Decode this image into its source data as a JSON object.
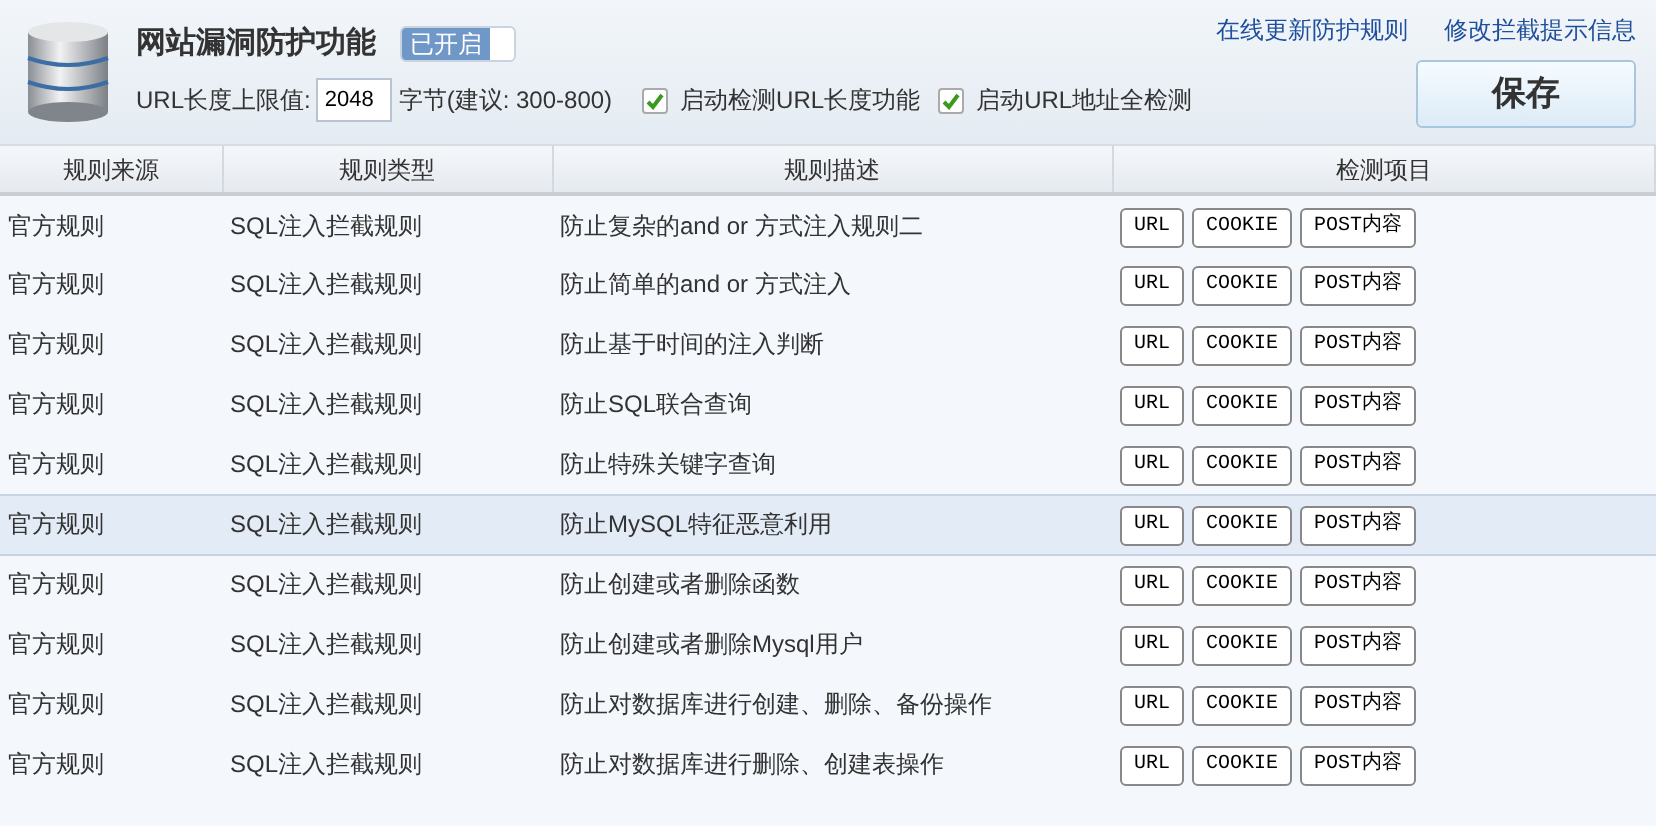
{
  "header": {
    "title": "网站漏洞防护功能",
    "toggle": {
      "label": "已开启",
      "on": true
    },
    "url_limit": {
      "label": "URL长度上限值:",
      "value": "2048",
      "suffix": "字节(建议: 300-800)"
    },
    "options": [
      {
        "label": "启动检测URL长度功能",
        "checked": true
      },
      {
        "label": "启动URL地址全检测",
        "checked": true
      }
    ],
    "links": [
      "在线更新防护规则",
      "修改拦截提示信息"
    ],
    "save_button": "保存"
  },
  "table": {
    "columns": [
      "规则来源",
      "规则类型",
      "规则描述",
      "检测项目"
    ],
    "rows": [
      {
        "source": "官方规则",
        "type": "SQL注入拦截规则",
        "description": "防止复杂的and or 方式注入规则二",
        "checks": [
          "URL",
          "COOKIE",
          "POST内容"
        ],
        "selected": false
      },
      {
        "source": "官方规则",
        "type": "SQL注入拦截规则",
        "description": "防止简单的and or 方式注入",
        "checks": [
          "URL",
          "COOKIE",
          "POST内容"
        ],
        "selected": false
      },
      {
        "source": "官方规则",
        "type": "SQL注入拦截规则",
        "description": "防止基于时间的注入判断",
        "checks": [
          "URL",
          "COOKIE",
          "POST内容"
        ],
        "selected": false
      },
      {
        "source": "官方规则",
        "type": "SQL注入拦截规则",
        "description": "防止SQL联合查询",
        "checks": [
          "URL",
          "COOKIE",
          "POST内容"
        ],
        "selected": false
      },
      {
        "source": "官方规则",
        "type": "SQL注入拦截规则",
        "description": "防止特殊关键字查询",
        "checks": [
          "URL",
          "COOKIE",
          "POST内容"
        ],
        "selected": false
      },
      {
        "source": "官方规则",
        "type": "SQL注入拦截规则",
        "description": "防止MySQL特征恶意利用",
        "checks": [
          "URL",
          "COOKIE",
          "POST内容"
        ],
        "selected": true
      },
      {
        "source": "官方规则",
        "type": "SQL注入拦截规则",
        "description": "防止创建或者删除函数",
        "checks": [
          "URL",
          "COOKIE",
          "POST内容"
        ],
        "selected": false
      },
      {
        "source": "官方规则",
        "type": "SQL注入拦截规则",
        "description": "防止创建或者删除Mysql用户",
        "checks": [
          "URL",
          "COOKIE",
          "POST内容"
        ],
        "selected": false
      },
      {
        "source": "官方规则",
        "type": "SQL注入拦截规则",
        "description": "防止对数据库进行创建、删除、备份操作",
        "checks": [
          "URL",
          "COOKIE",
          "POST内容"
        ],
        "selected": false
      },
      {
        "source": "官方规则",
        "type": "SQL注入拦截规则",
        "description": "防止对数据库进行删除、创建表操作",
        "checks": [
          "URL",
          "COOKIE",
          "POST内容"
        ],
        "selected": false
      }
    ]
  }
}
